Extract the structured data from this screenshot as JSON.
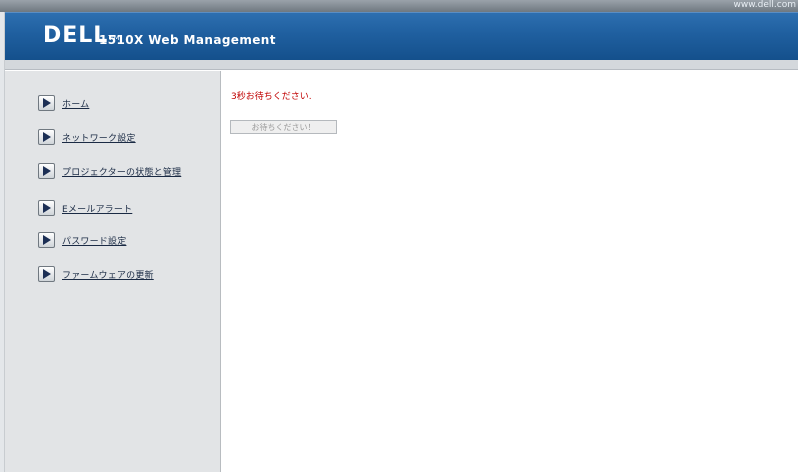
{
  "header": {
    "site_url": "www.dell.com",
    "logo_text": "DELL",
    "logo_tm": "TM",
    "product_title": "1510X Web Management"
  },
  "sidebar": {
    "items": [
      {
        "label": "ホーム",
        "icon": "play-arrow-icon"
      },
      {
        "label": "ネットワーク設定",
        "icon": "play-arrow-icon"
      },
      {
        "label": "プロジェクターの状態と管理",
        "icon": "play-arrow-icon"
      },
      {
        "label": "Eメールアラート",
        "icon": "play-arrow-icon"
      },
      {
        "label": "パスワード設定",
        "icon": "play-arrow-icon"
      },
      {
        "label": "ファームウェアの更新",
        "icon": "play-arrow-icon"
      }
    ]
  },
  "main": {
    "wait_message": "3秒お待ちください.",
    "wait_button_label": "お待ちください！"
  },
  "colors": {
    "banner": "#1f5f9f",
    "sidebar_bg": "#e2e4e6",
    "wait_message": "#c00000",
    "link": "#1a2a44"
  }
}
